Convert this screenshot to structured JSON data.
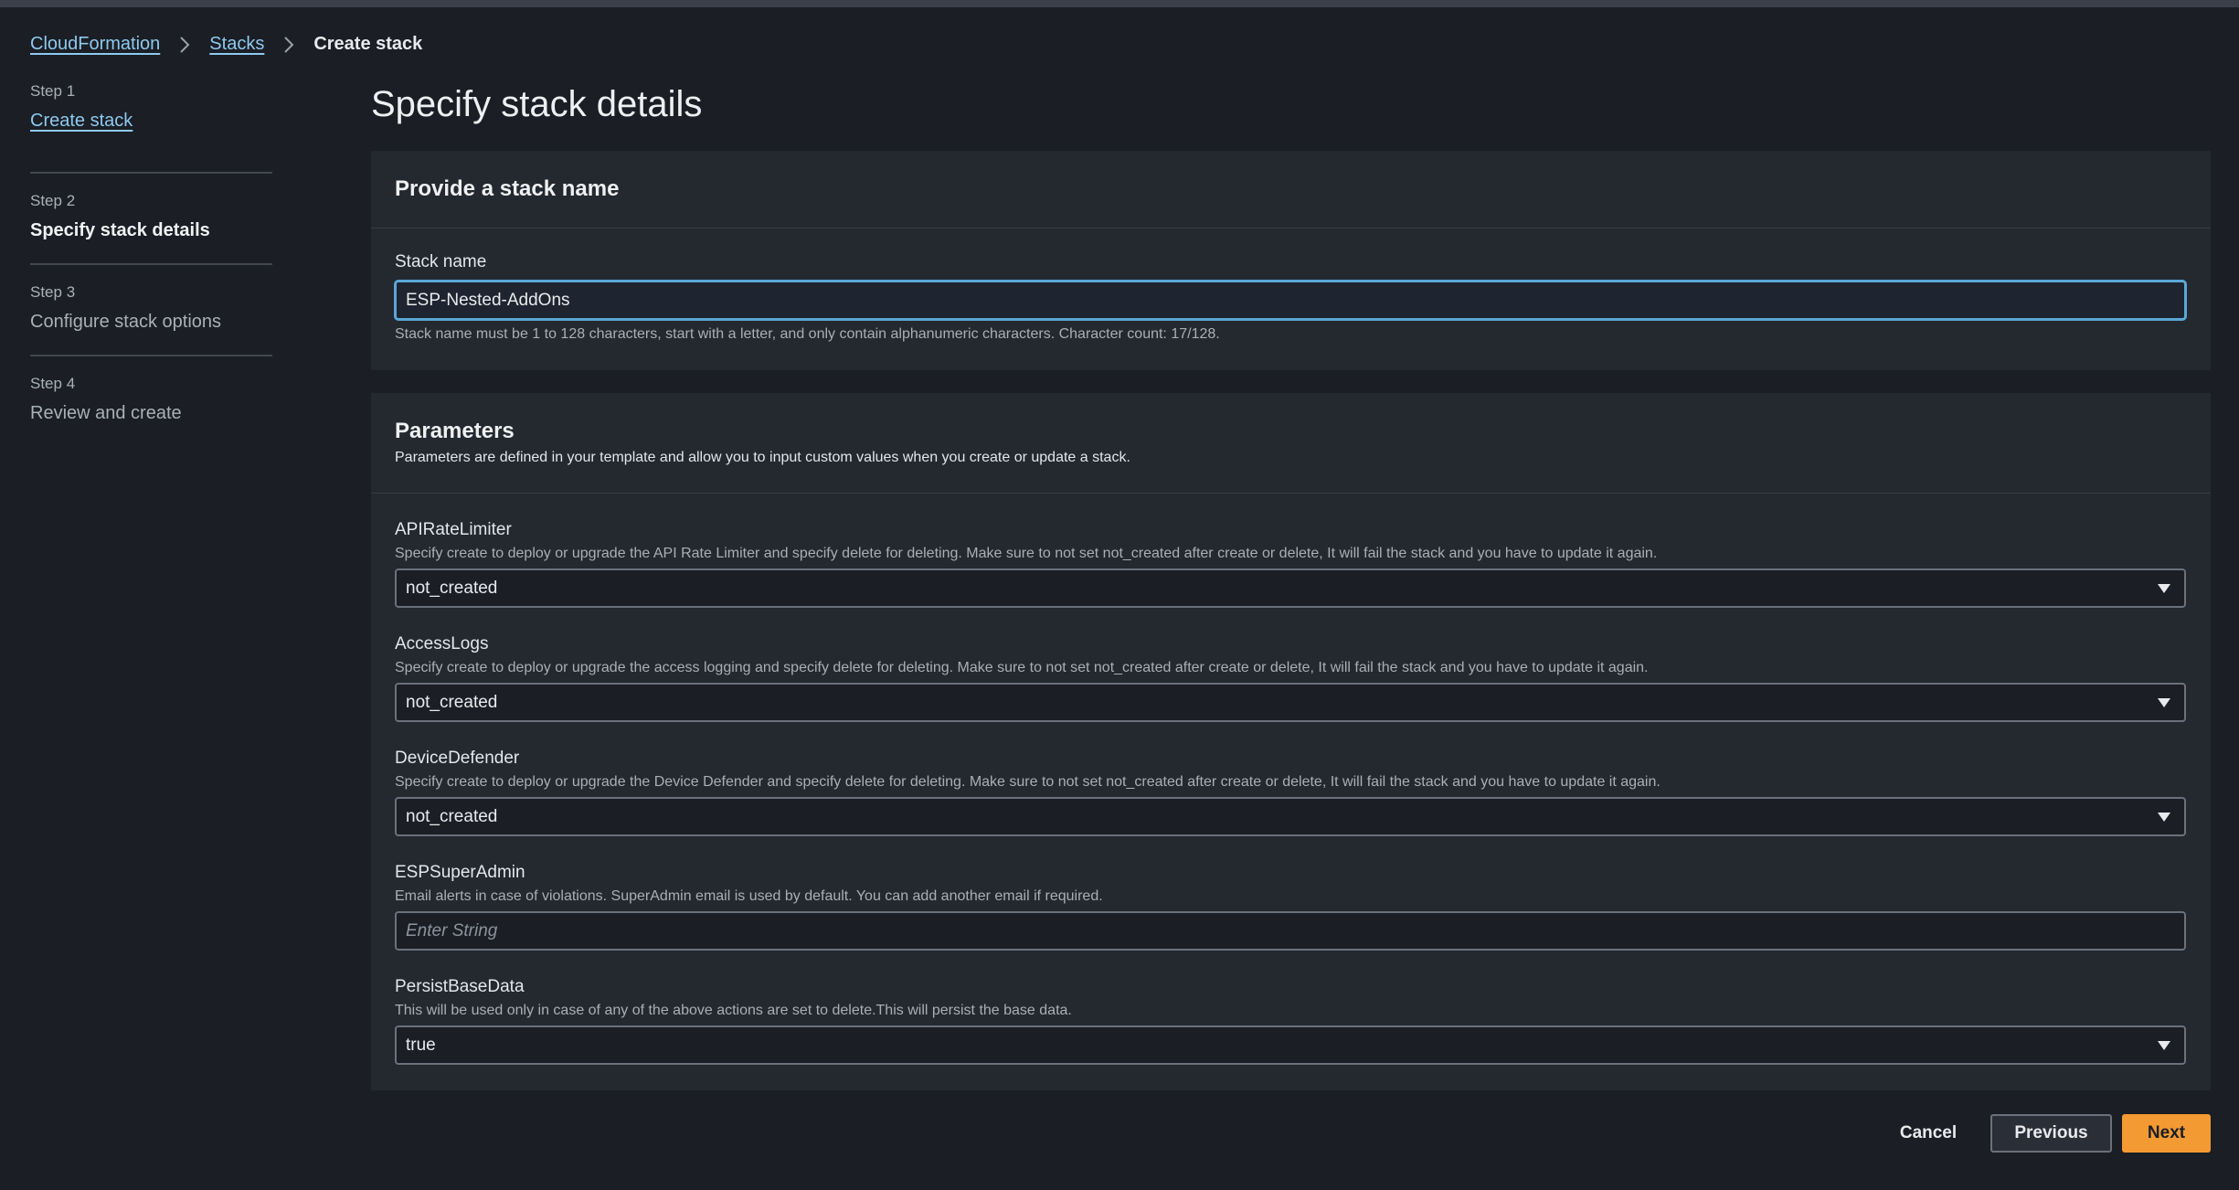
{
  "breadcrumb": {
    "items": [
      "CloudFormation",
      "Stacks"
    ],
    "current": "Create stack"
  },
  "steps": [
    {
      "num": "Step 1",
      "label": "Create stack",
      "state": "link"
    },
    {
      "num": "Step 2",
      "label": "Specify stack details",
      "state": "active"
    },
    {
      "num": "Step 3",
      "label": "Configure stack options",
      "state": "inactive"
    },
    {
      "num": "Step 4",
      "label": "Review and create",
      "state": "inactive"
    }
  ],
  "page": {
    "title": "Specify stack details"
  },
  "stack_name_panel": {
    "title": "Provide a stack name",
    "label": "Stack name",
    "value": "ESP-Nested-AddOns",
    "help": "Stack name must be 1 to 128 characters, start with a letter, and only contain alphanumeric characters. Character count: 17/128."
  },
  "parameters_panel": {
    "title": "Parameters",
    "subtitle": "Parameters are defined in your template and allow you to input custom values when you create or update a stack.",
    "params": [
      {
        "name": "APIRateLimiter",
        "desc": "Specify create to deploy or upgrade the API Rate Limiter and specify delete for deleting. Make sure to not set not_created after create or delete, It will fail the stack and you have to update it again.",
        "type": "select",
        "value": "not_created"
      },
      {
        "name": "AccessLogs",
        "desc": "Specify create to deploy or upgrade the access logging and specify delete for deleting. Make sure to not set not_created after create or delete, It will fail the stack and you have to update it again.",
        "type": "select",
        "value": "not_created"
      },
      {
        "name": "DeviceDefender",
        "desc": "Specify create to deploy or upgrade the Device Defender and specify delete for deleting. Make sure to not set not_created after create or delete, It will fail the stack and you have to update it again.",
        "type": "select",
        "value": "not_created"
      },
      {
        "name": "ESPSuperAdmin",
        "desc": "Email alerts in case of violations. SuperAdmin email is used by default. You can add another email if required.",
        "type": "input",
        "placeholder": "Enter String"
      },
      {
        "name": "PersistBaseData",
        "desc": "This will be used only in case of any of the above actions are set to delete.This will persist the base data.",
        "type": "select",
        "value": "true"
      }
    ]
  },
  "footer": {
    "cancel": "Cancel",
    "previous": "Previous",
    "next": "Next"
  },
  "colors": {
    "accent": "#f39a32",
    "link": "#8ec9ee",
    "focus": "#5aa8d6"
  }
}
